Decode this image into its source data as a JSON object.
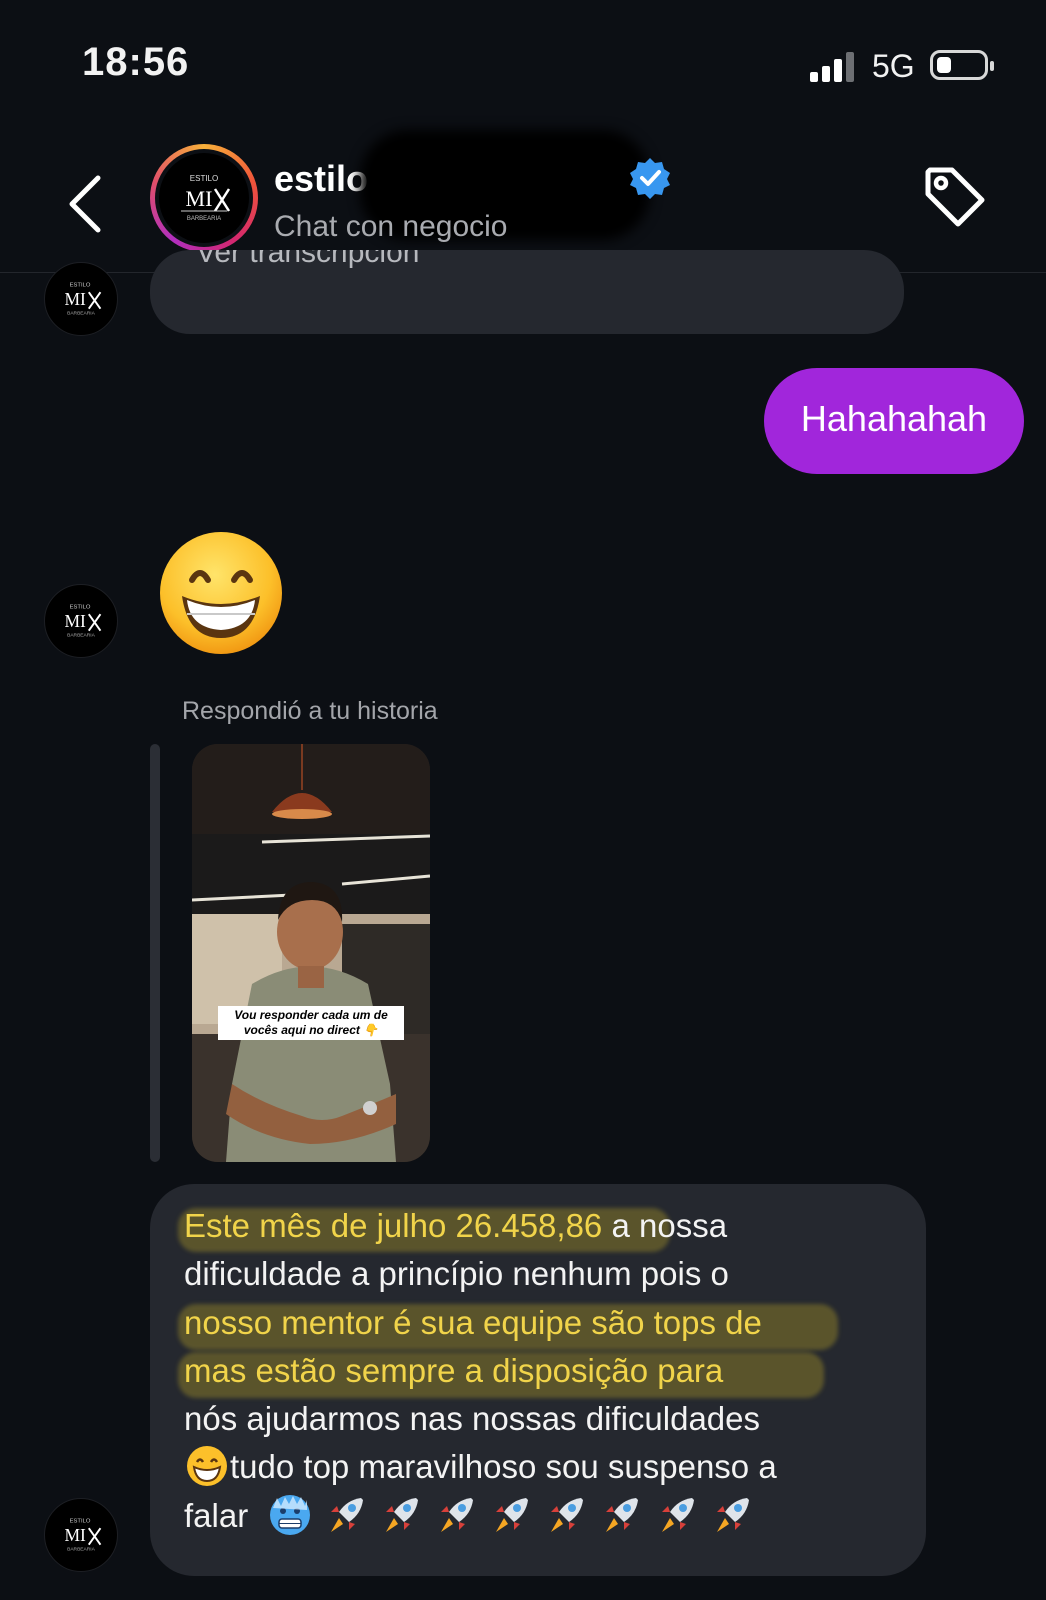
{
  "status_bar": {
    "time": "18:56",
    "network": "5G"
  },
  "header": {
    "name": "estilo",
    "subtitle": "Chat con negocio",
    "verified": true,
    "avatar_logo_text": "MIX",
    "avatar_logo_top": "ESTILO",
    "avatar_logo_bottom": "BARBEARIA"
  },
  "icons": {
    "back": "chevron-left-icon",
    "tag": "tag-icon",
    "verified": "verified-badge-icon"
  },
  "messages": {
    "prev_cut_text": "Ver transcripción",
    "outgoing_text": "Hahahahah",
    "emoji_reply": "grinning-face",
    "reply_label": "Respondió a tu historia",
    "story_caption_line1": "Vou responder cada um de",
    "story_caption_line2": "vocês aqui no direct 👇",
    "main_message": {
      "line1_highlight": "Este mês de julho 26.458,86",
      "line1_rest": " a nossa",
      "line2": "dificuldade a princípio nenhum pois o",
      "line3_highlight": "nosso mentor é sua equipe são tops de",
      "line4_highlight": "mas estão sempre a disposição para",
      "line5": "nós ajudarmos nas nossas dificuldades",
      "line6": "tudo top maravilhoso sou suspenso a",
      "line7": "falar"
    }
  },
  "colors": {
    "background": "#0c0f14",
    "incoming_bubble": "#25282f",
    "outgoing_bubble": "#a126db",
    "highlight": "#f1d44a",
    "verified_blue": "#3897f0"
  }
}
